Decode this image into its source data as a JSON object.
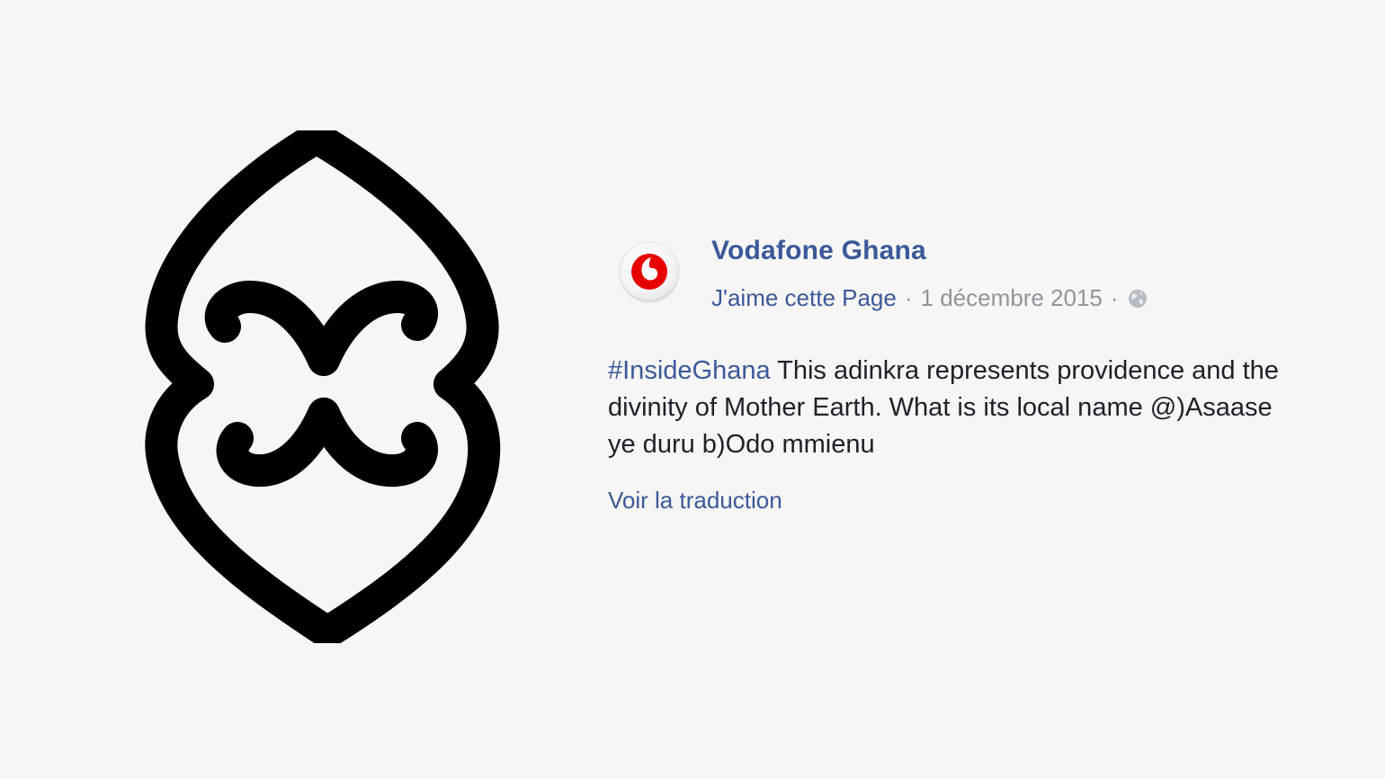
{
  "post": {
    "page_name": "Vodafone Ghana",
    "like_page": "J'aime cette Page",
    "separator": "·",
    "date": "1 décembre 2015",
    "privacy_icon": "globe-icon",
    "hashtag": "#InsideGhana",
    "text": "This adinkra represents providence and the divinity of Mother Earth. What is its local name @)Asaase ye duru b)Odo mmienu",
    "translate_link": "Voir la traduction"
  },
  "avatar": {
    "icon": "vodafone-logo-icon",
    "brand_color": "#e60000"
  },
  "colors": {
    "link": "#3b5998",
    "meta": "#90949c",
    "text": "#1d2129",
    "background": "#f6f6f6"
  },
  "symbol": {
    "icon": "adinkra-symbol-icon",
    "color": "#000000"
  }
}
